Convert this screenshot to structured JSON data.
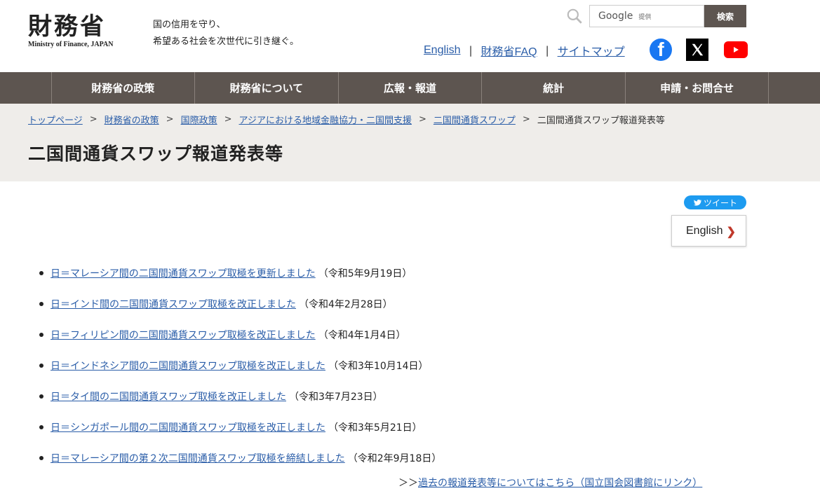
{
  "header": {
    "logo_kanji": "財務省",
    "logo_en": "Ministry of Finance, JAPAN",
    "tagline_line1": "国の信用を守り、",
    "tagline_line2": "希望ある社会を次世代に引き継ぐ。",
    "search": {
      "brand": "Google",
      "provided": "提供",
      "button": "検索"
    },
    "util_links": [
      "English",
      "財務省FAQ",
      "サイトマップ"
    ],
    "util_sep": "|",
    "social": [
      "facebook-icon",
      "x-icon",
      "youtube-icon"
    ]
  },
  "nav": {
    "items": [
      "財務省の政策",
      "財務省について",
      "広報・報道",
      "統計",
      "申請・お問合せ"
    ]
  },
  "breadcrumb": {
    "items": [
      "トップページ",
      "財務省の政策",
      "国際政策",
      "アジアにおける地域金融協力・二国間支援",
      "二国間通貨スワップ"
    ],
    "current": "二国間通貨スワップ報道発表等",
    "sep": ">"
  },
  "page_title": "二国間通貨スワップ報道発表等",
  "tweet_label": "ツイート",
  "english_button": "English",
  "press": [
    {
      "title": "日＝マレーシア間の二国間通貨スワップ取極を更新しました",
      "date": "（令和5年9月19日）"
    },
    {
      "title": "日＝インド間の二国間通貨スワップ取極を改正しました",
      "date": "（令和4年2月28日）"
    },
    {
      "title": "日＝フィリピン間の二国間通貨スワップ取極を改正しました",
      "date": "（令和4年1月4日）"
    },
    {
      "title": "日＝インドネシア間の二国間通貨スワップ取極を改正しました",
      "date": "（令和3年10月14日）"
    },
    {
      "title": "日＝タイ間の二国間通貨スワップ取極を改正しました",
      "date": "（令和3年7月23日）"
    },
    {
      "title": "日＝シンガポール間の二国間通貨スワップ取極を改正しました",
      "date": "（令和3年5月21日）"
    },
    {
      "title": "日＝マレーシア間の第２次二国間通貨スワップ取極を締結しました",
      "date": "（令和2年9月18日）"
    }
  ],
  "archive": {
    "prefix": "＞＞",
    "link": "過去の報道発表等についてはこちら（国立国会図書館にリンク）"
  },
  "colors": {
    "nav_bg": "#5d5550",
    "band_bg": "#efedea",
    "link": "#2a5da8",
    "tweet": "#1d9bf0"
  }
}
